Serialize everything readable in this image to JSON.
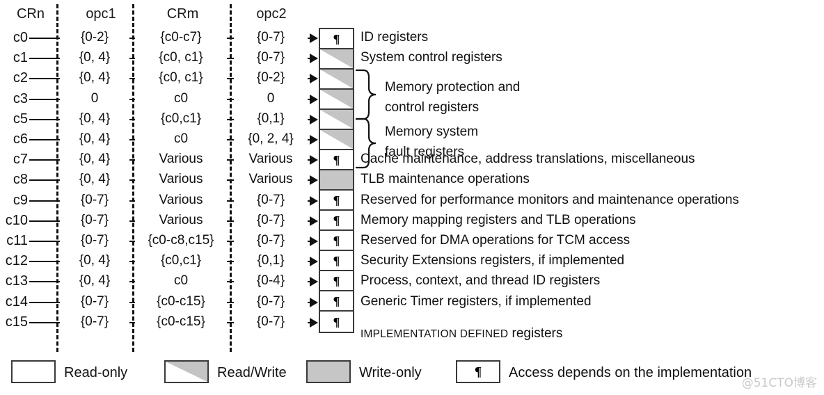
{
  "headers": {
    "crn": "CRn",
    "opc1": "opc1",
    "crm": "CRm",
    "opc2": "opc2"
  },
  "rows": [
    {
      "crn": "c0",
      "opc1": "{0-2}",
      "crm": "{c0-c7}",
      "opc2": "{0-7}",
      "access": "impl",
      "access_glyph": "¶",
      "desc": "ID registers"
    },
    {
      "crn": "c1",
      "opc1": "{0, 4}",
      "crm": "{c0, c1}",
      "opc2": "{0-7}",
      "access": "rw",
      "access_glyph": "",
      "desc": "System control registers"
    },
    {
      "crn": "c2",
      "opc1": "{0, 4}",
      "crm": "{c0, c1}",
      "opc2": "{0-2}",
      "access": "rw",
      "access_glyph": "",
      "desc": ""
    },
    {
      "crn": "c3",
      "opc1": "0",
      "crm": "c0",
      "opc2": "0",
      "access": "rw",
      "access_glyph": "",
      "desc": ""
    },
    {
      "crn": "c5",
      "opc1": "{0, 4}",
      "crm": "{c0,c1}",
      "opc2": "{0,1}",
      "access": "rw",
      "access_glyph": "",
      "desc": ""
    },
    {
      "crn": "c6",
      "opc1": "{0, 4}",
      "crm": "c0",
      "opc2": "{0, 2, 4}",
      "access": "rw",
      "access_glyph": "",
      "desc": ""
    },
    {
      "crn": "c7",
      "opc1": "{0, 4}",
      "crm": "Various",
      "opc2": "Various",
      "access": "impl",
      "access_glyph": "¶",
      "desc": "Cache maintenance, address translations, miscellaneous"
    },
    {
      "crn": "c8",
      "opc1": "{0, 4}",
      "crm": "Various",
      "opc2": "Various",
      "access": "wo",
      "access_glyph": "",
      "desc": "TLB maintenance operations"
    },
    {
      "crn": "c9",
      "opc1": "{0-7}",
      "crm": "Various",
      "opc2": "{0-7}",
      "access": "impl",
      "access_glyph": "¶",
      "desc": "Reserved for performance monitors and maintenance operations"
    },
    {
      "crn": "c10",
      "opc1": "{0-7}",
      "crm": "Various",
      "opc2": "{0-7}",
      "access": "impl",
      "access_glyph": "¶",
      "desc": "Memory mapping registers and TLB operations"
    },
    {
      "crn": "c11",
      "opc1": "{0-7}",
      "crm": "{c0-c8,c15}",
      "opc2": "{0-7}",
      "access": "impl",
      "access_glyph": "¶",
      "desc": "Reserved for DMA operations for TCM access"
    },
    {
      "crn": "c12",
      "opc1": "{0, 4}",
      "crm": "{c0,c1}",
      "opc2": "{0,1}",
      "access": "impl",
      "access_glyph": "¶",
      "desc": "Security Extensions registers, if implemented"
    },
    {
      "crn": "c13",
      "opc1": "{0, 4}",
      "crm": "c0",
      "opc2": "{0-4}",
      "access": "impl",
      "access_glyph": "¶",
      "desc": "Process, context, and thread ID registers"
    },
    {
      "crn": "c14",
      "opc1": "{0-7}",
      "crm": "{c0-c15}",
      "opc2": "{0-7}",
      "access": "impl",
      "access_glyph": "¶",
      "desc": "Generic Timer registers, if implemented"
    },
    {
      "crn": "c15",
      "opc1": "{0-7}",
      "crm": "{c0-c15}",
      "opc2": "{0-7}",
      "access": "impl",
      "access_glyph": "¶",
      "desc": ""
    }
  ],
  "row15_desc": {
    "caps": "IMPLEMENTATION DEFINED",
    "rest": " registers"
  },
  "groups": [
    {
      "line1": "Memory protection and",
      "line2": "control registers"
    },
    {
      "line1": "Memory system",
      "line2": "fault registers"
    }
  ],
  "legend": [
    {
      "key": "read-only",
      "label": "Read-only",
      "glyph": ""
    },
    {
      "key": "read-write",
      "label": "Read/Write",
      "glyph": ""
    },
    {
      "key": "write-only",
      "label": "Write-only",
      "glyph": ""
    },
    {
      "key": "impl",
      "label": "Access depends on the implementation",
      "glyph": "¶"
    }
  ],
  "watermark": "@51CTO博客",
  "colors": {
    "ink": "#111111",
    "gray_fill": "#c6c6c6",
    "rw_gray": "#c4c4c4",
    "box_border": "#3a3a3a",
    "watermark": "#c9c9c9"
  }
}
